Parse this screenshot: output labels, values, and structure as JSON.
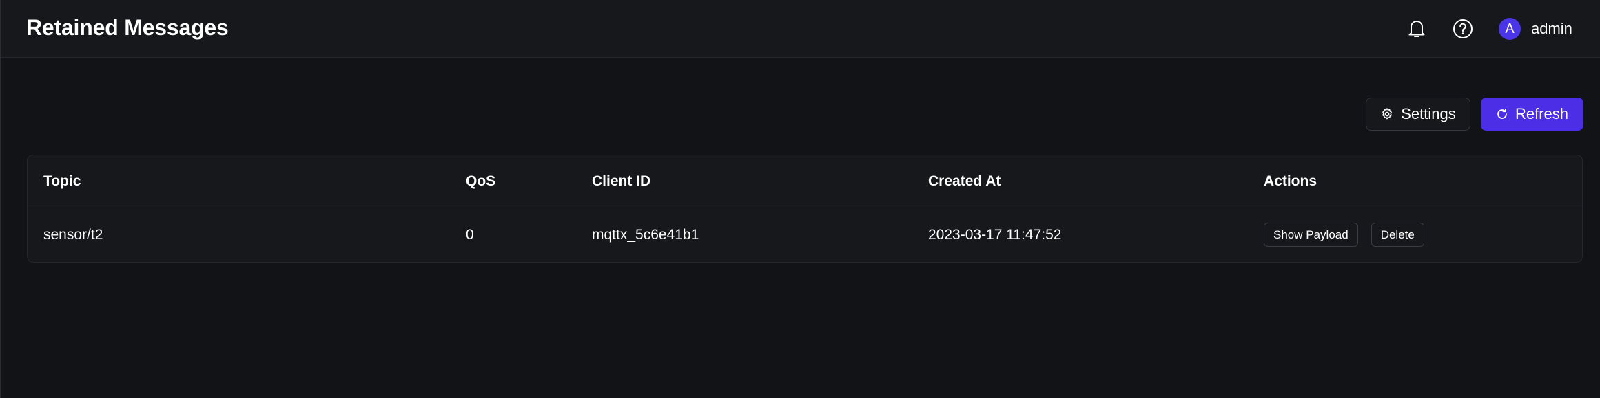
{
  "header": {
    "title": "Retained Messages",
    "notifications_icon": "bell-icon",
    "help_icon": "question-circle-icon",
    "user": {
      "avatar_initial": "A",
      "name": "admin",
      "avatar_color": "#4a35e8"
    }
  },
  "toolbar": {
    "settings_label": "Settings",
    "settings_icon": "gear-icon",
    "refresh_label": "Refresh",
    "refresh_icon": "refresh-icon",
    "accent_color": "#4b2ee6"
  },
  "table": {
    "columns": [
      "Topic",
      "QoS",
      "Client ID",
      "Created At",
      "Actions"
    ],
    "rows": [
      {
        "topic": "sensor/t2",
        "qos": "0",
        "client_id": "mqttx_5c6e41b1",
        "created_at": "2023-03-17 11:47:52",
        "actions": [
          "Show Payload",
          "Delete"
        ]
      }
    ]
  }
}
